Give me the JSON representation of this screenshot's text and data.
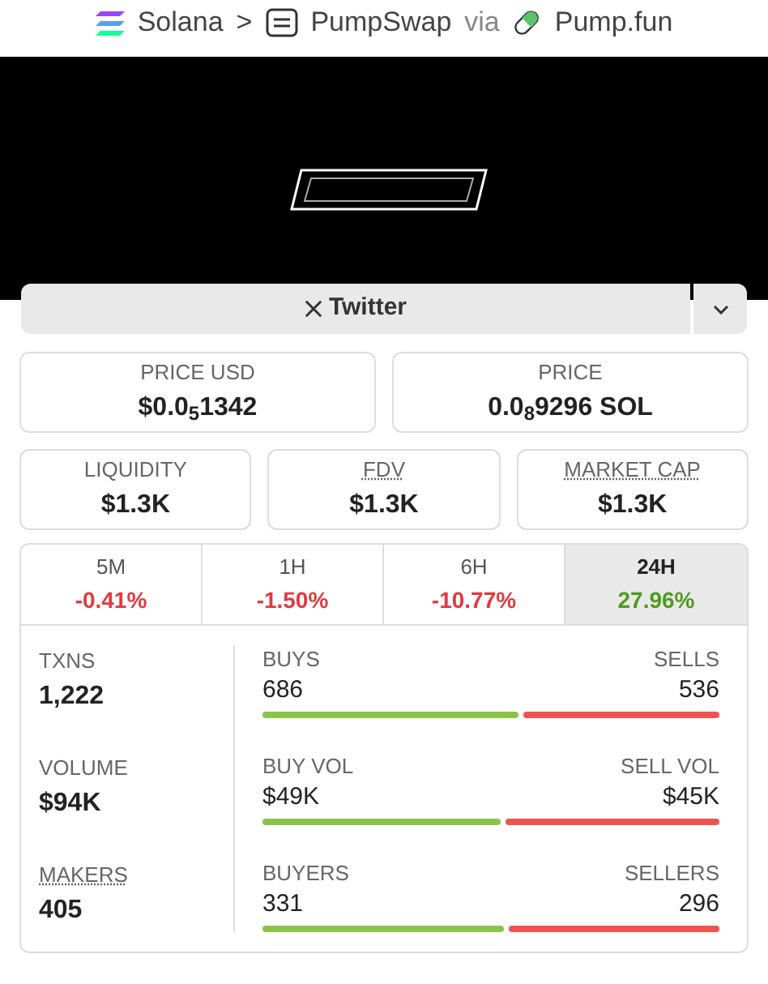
{
  "breadcrumb": {
    "chain": "Solana",
    "separator": ">",
    "dex": "PumpSwap",
    "via": "via",
    "launchpad": "Pump.fun"
  },
  "social_button": {
    "label": "Twitter"
  },
  "prices": [
    {
      "label": "PRICE USD",
      "value": "$0.0$_{5}$1342"
    },
    {
      "label": "PRICE",
      "value": "0.0$_{8}$9296 SOL"
    }
  ],
  "metrics": [
    {
      "label": "LIQUIDITY",
      "value": "$1.3K",
      "dotted": false
    },
    {
      "label": "FDV",
      "value": "$1.3K",
      "dotted": true
    },
    {
      "label": "MARKET CAP",
      "value": "$1.3K",
      "dotted": true
    }
  ],
  "tabs": [
    {
      "label": "5M",
      "change": "-0.41%",
      "color": "#e0393e",
      "selected": false
    },
    {
      "label": "1H",
      "change": "-1.50%",
      "color": "#e0393e",
      "selected": false
    },
    {
      "label": "6H",
      "change": "-10.77%",
      "color": "#e0393e",
      "selected": false
    },
    {
      "label": "24H",
      "change": "27.96%",
      "color": "#4f9a1e",
      "selected": true
    }
  ],
  "stats": [
    {
      "label": "TXNS",
      "value": "1,222",
      "dotted": false,
      "left_label": "BUYS",
      "left_value": "686",
      "right_label": "SELLS",
      "right_value": "536",
      "level": 0.56
    },
    {
      "label": "VOLUME",
      "value": "$94K",
      "dotted": false,
      "left_label": "BUY VOL",
      "left_value": "$49K",
      "right_label": "SELL VOL",
      "right_value": "$45K",
      "level": 0.52
    },
    {
      "label": "MAKERS",
      "value": "405",
      "dotted": true,
      "left_label": "BUYERS",
      "left_value": "331",
      "right_label": "SELLERS",
      "right_value": "296",
      "level": 0.53
    }
  ]
}
